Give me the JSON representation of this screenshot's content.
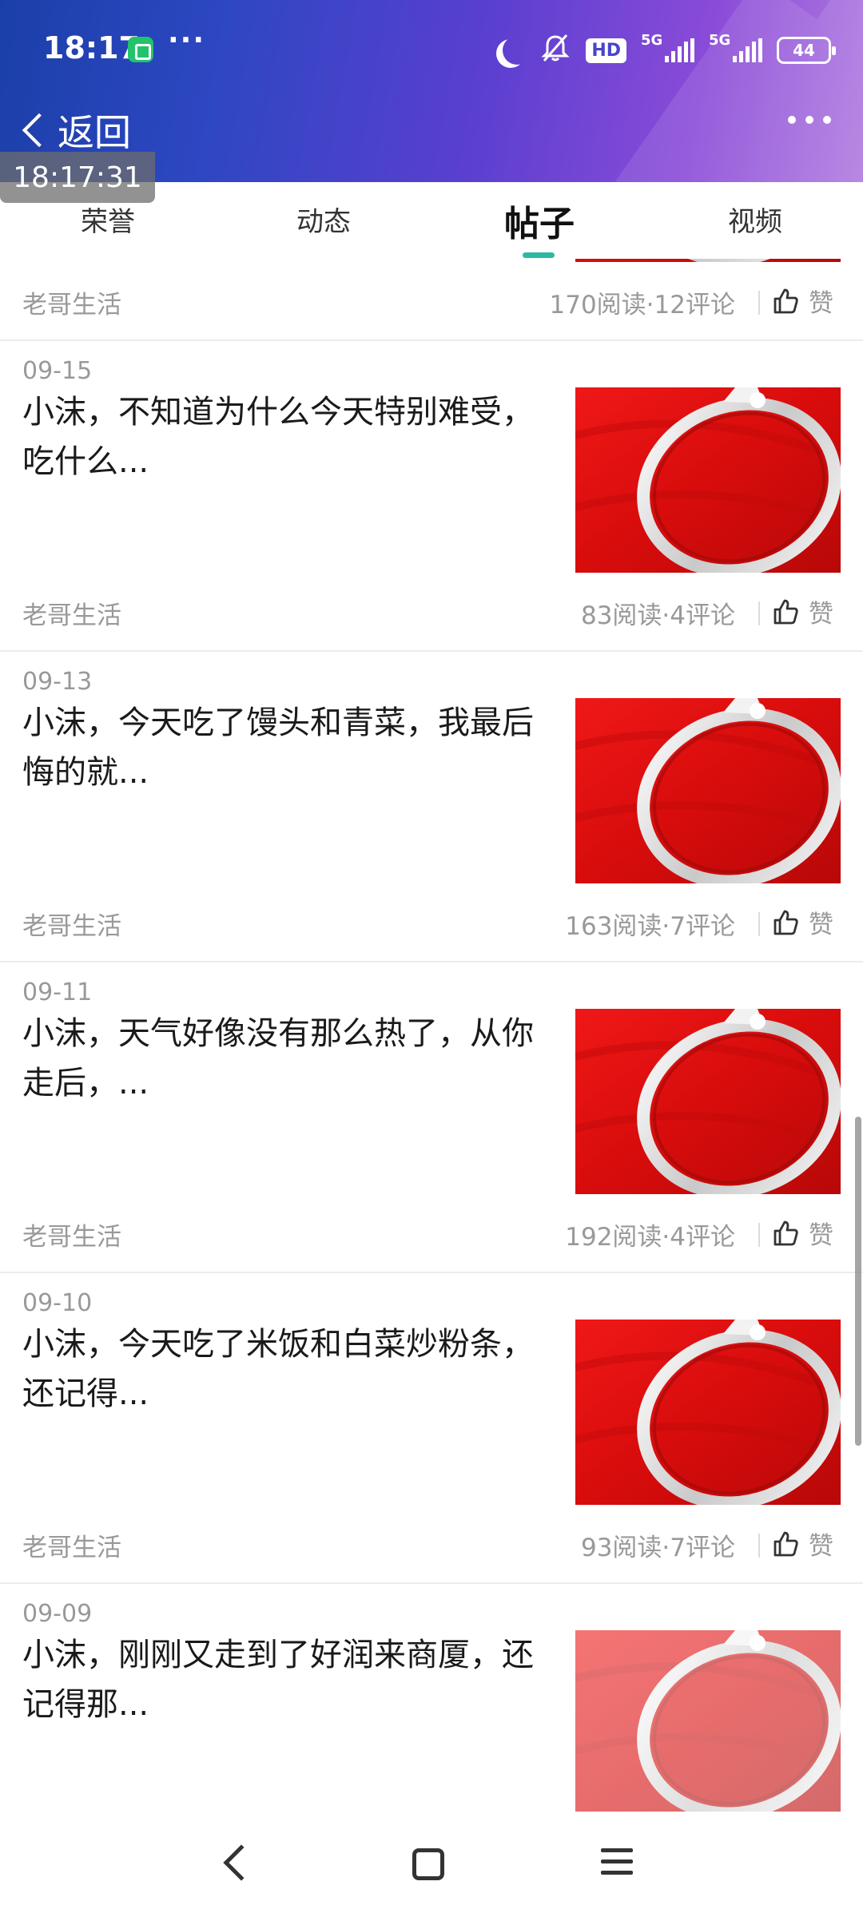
{
  "status_bar": {
    "time": "18:17",
    "more": "···",
    "hd_label": "HD",
    "signal1_label": "5G",
    "signal2_label": "5G",
    "battery": "44"
  },
  "nav": {
    "back_label": "返回",
    "screenshot_timestamp": "18:17:31"
  },
  "tabs": [
    {
      "label": "荣誉",
      "active": false
    },
    {
      "label": "动态",
      "active": false
    },
    {
      "label": "帖子",
      "active": true
    },
    {
      "label": "视频",
      "active": false
    }
  ],
  "posts": [
    {
      "date": "",
      "title": "",
      "author": "老哥生活",
      "stats": "170阅读·12评论",
      "like_label": "赞"
    },
    {
      "date": "09-15",
      "title": "小沫，不知道为什么今天特别难受，吃什么...",
      "author": "老哥生活",
      "stats": "83阅读·4评论",
      "like_label": "赞"
    },
    {
      "date": "09-13",
      "title": "小沫，今天吃了馒头和青菜，我最后悔的就...",
      "author": "老哥生活",
      "stats": "163阅读·7评论",
      "like_label": "赞"
    },
    {
      "date": "09-11",
      "title": "小沫，天气好像没有那么热了，从你走后，...",
      "author": "老哥生活",
      "stats": "192阅读·4评论",
      "like_label": "赞"
    },
    {
      "date": "09-10",
      "title": "小沫，今天吃了米饭和白菜炒粉条，还记得...",
      "author": "老哥生活",
      "stats": "93阅读·7评论",
      "like_label": "赞"
    },
    {
      "date": "09-09",
      "title": "小沫，刚刚又走到了好润来商厦，还记得那...",
      "author": "老哥生活",
      "stats": "",
      "like_label": ""
    }
  ],
  "colors": {
    "tab_indicator": "#2bb9a2",
    "thumb_red": "#e01010",
    "muted_text": "#999999"
  },
  "icons": {
    "like": "thumb-up-icon",
    "back": "chevron-left-icon",
    "menu": "more-dots-icon"
  }
}
